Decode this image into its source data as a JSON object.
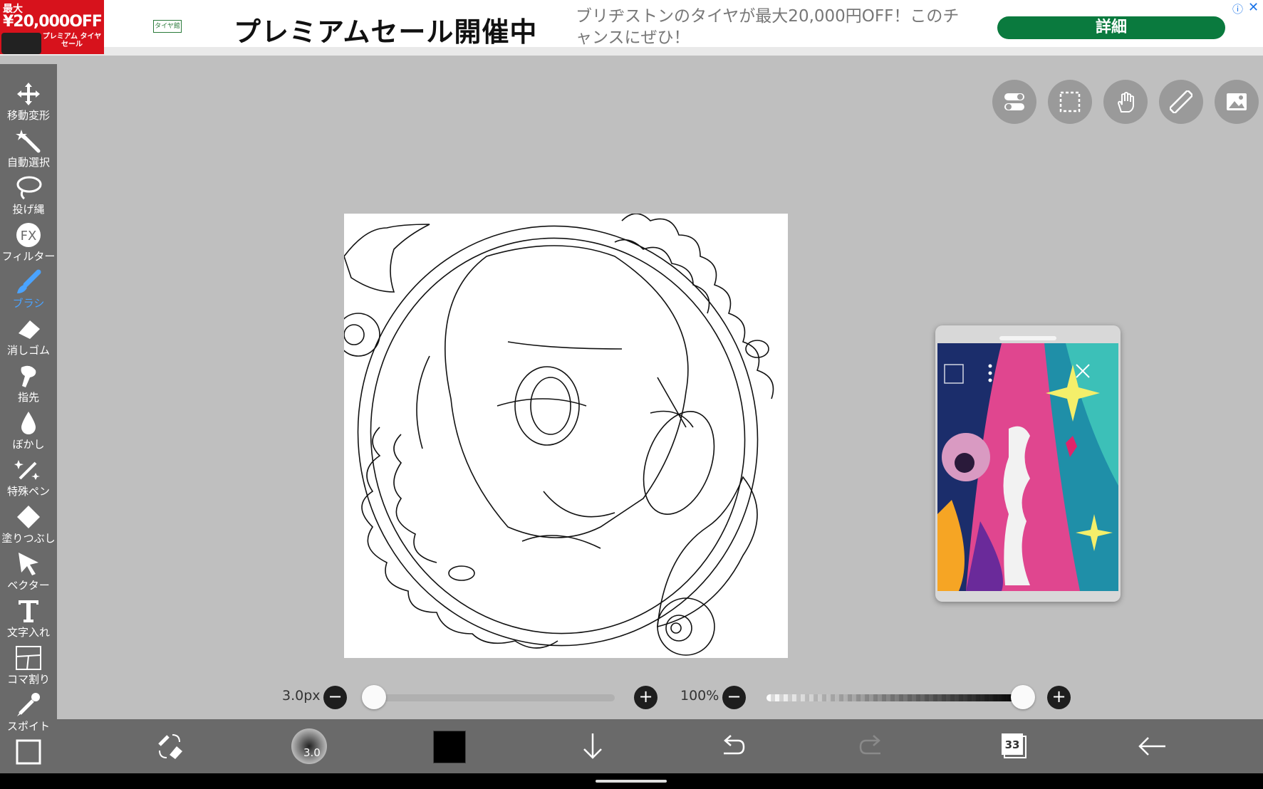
{
  "ad": {
    "image_small": "最大",
    "image_big": "¥20,000OFF",
    "image_tag": "プレミアム タイヤセール",
    "logo": "タイヤ館",
    "title": "プレミアムセール開催中",
    "description": "ブリヂストンのタイヤが最大20,000円OFF！このチャンスにぜひ！",
    "cta": "詳細",
    "info_icon": "info-icon",
    "close_icon": "close-icon"
  },
  "toolbar": {
    "items": [
      {
        "label": "移動変形",
        "icon": "move-icon"
      },
      {
        "label": "自動選択",
        "icon": "magic-wand-icon"
      },
      {
        "label": "投げ縄",
        "icon": "lasso-icon"
      },
      {
        "label": "フィルター",
        "icon": "fx-icon"
      },
      {
        "label": "ブラシ",
        "icon": "brush-icon",
        "active": true
      },
      {
        "label": "消しゴム",
        "icon": "eraser-icon"
      },
      {
        "label": "指先",
        "icon": "finger-icon"
      },
      {
        "label": "ぼかし",
        "icon": "blur-drop-icon"
      },
      {
        "label": "特殊ペン",
        "icon": "special-pen-icon"
      },
      {
        "label": "塗りつぶし",
        "icon": "fill-bucket-icon"
      },
      {
        "label": "ベクター",
        "icon": "vector-cursor-icon"
      },
      {
        "label": "文字入れ",
        "icon": "text-icon"
      },
      {
        "label": "コマ割り",
        "icon": "frame-divider-icon"
      },
      {
        "label": "スポイト",
        "icon": "eyedropper-icon"
      }
    ]
  },
  "top_buttons": [
    "toggle-icon",
    "selection-icon",
    "hand-icon",
    "ruler-icon",
    "reference-image-icon"
  ],
  "brush": {
    "size_label": "3.0px",
    "size_fraction": 0.0,
    "opacity_label": "100%",
    "opacity_fraction": 1.0,
    "minus": "−",
    "plus": "+"
  },
  "bottom": {
    "brush_preview_value": "3.0",
    "color": "#000000",
    "layers_count": "33"
  }
}
